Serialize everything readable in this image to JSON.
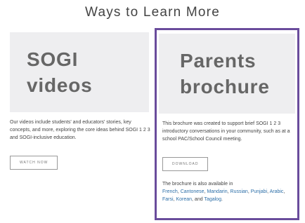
{
  "section_title": "Ways to Learn More",
  "cards": {
    "videos": {
      "hero_line1": "SOGI",
      "hero_line2": "videos",
      "description": "Our videos include students' and educators' stories, key concepts, and more, exploring the core ideas behind SOGI 1 2 3 and SOGI-inclusive education.",
      "button_label": "WATCH NOW"
    },
    "parents": {
      "hero_line1": "Parents",
      "hero_line2": "brochure",
      "description": "This brochure was created to support brief SOGI 1 2 3 introductory conversations in your community, such as at a school PAC/School Council meeting.",
      "button_label": "DOWNLOAD",
      "availability_prefix": "The brochure is also available in",
      "languages": [
        "French",
        "Cantonese",
        "Mandarin",
        "Russian",
        "Punjabi",
        "Arabic",
        "Farsi",
        "Korean",
        "Tagalog"
      ],
      "and_word": "and",
      "period": "."
    }
  },
  "colors": {
    "highlight_border": "#6a4c9c",
    "link": "#2d6fa8",
    "hero_bg": "#eeeef0"
  }
}
